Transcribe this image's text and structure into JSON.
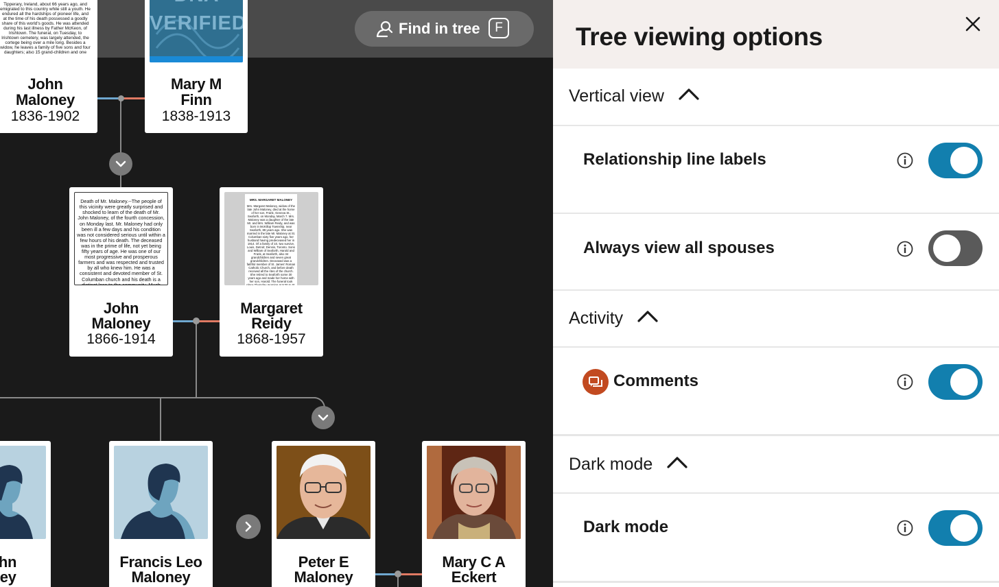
{
  "find_button": {
    "label": "Find in tree",
    "shortcut": "F"
  },
  "badge": {
    "line1": "DNA",
    "line2": "VERIFIED"
  },
  "people": [
    {
      "first": "John",
      "last": "Maloney",
      "years": "1836-1902"
    },
    {
      "first": "Mary M",
      "last": "Finn",
      "years": "1838-1913"
    },
    {
      "first": "John",
      "last": "Maloney",
      "years": "1866-1914"
    },
    {
      "first": "Margaret",
      "last": "Reidy",
      "years": "1868-1957"
    },
    {
      "first": "John",
      "last": "oney",
      "years": ""
    },
    {
      "first": "Francis Leo",
      "last": "Maloney",
      "years": ""
    },
    {
      "first": "Peter E",
      "last": "Maloney",
      "years": ""
    },
    {
      "first": "Mary C A",
      "last": "Eckert",
      "years": ""
    }
  ],
  "clippings": {
    "top_left": "Tipperary, Ireland, about 66 years ago, and emigrated to this country while still a youth. He endured all the hardships of pioneer life, and at the time of his death possessed a goodly share of this world's goods. He was attended during his last illness by Father McKeon, of Irishtown. The funeral, on Tuesday, to Irishtown cemetery, was largely attended, the cortege being over a mile long. Besides a widow, he leaves a family of five sons and four daughters; also 15 grand-children and one",
    "john_1866": "Death of Mr. Maloney.--The people of this vicinity were greatly surprised and shocked to learn of the death of Mr. John Maloney, of the fourth concession, on Monday last. Mr. Maloney had only been ill a few days and his condition was not considered serious until within a few hours of his death. The deceased was in the prime of life, not yet being fifty years of age. He was one of our most progressive and prosperous farmers and was respected and trusted by all who knew him. He was a consistent and devoted member of St. Columban church and his death is a distinct loss to the community. Much sympathy is felt for the bereaved family and friends.",
    "margaret_title": "MRS. MARGARET MALONEY",
    "margaret_body": "Mrs. Margaret Maloney, widow of the late John Maloney, died at the home of her son, Frank, Geneva St., Seaforth, on Monday, March 7. Mrs. Maloney was a daughter of the late Mr. and Mrs. William Reidy, and was born in McKillop Township, near Seaforth, 89 years ago. She was married in the late Mr. Maloney at St. Columban sixty five years ago, her husband having predeceased her in 1914. Of a family of 10, two survive, Louis, Detroit; Dennis, Toronto. Sons and William of Seaforth, Harold and Frank, at Seaforth, also 34 grandchildren and seven great grandchildren. Deceased was a faithful member of St. James' Roman Catholic Church, and before death received all the rites of the church. She retired to Seaforth some 30 years ago and made her home with her son, Harold. The funeral took place Thursday morning at 9:30 to St. James' Church, where Requiem High Mass was celebrated by Rev. Father Lane. Burial was made in St. Columban cemetery. The pallbearers were six grandsons."
  },
  "panel": {
    "title": "Tree viewing options",
    "sections": {
      "vertical_view": "Vertical view",
      "activity": "Activity",
      "dark_mode": "Dark mode"
    },
    "options": {
      "relationship_labels": {
        "label": "Relationship line labels",
        "enabled": true
      },
      "all_spouses": {
        "label": "Always view all spouses",
        "enabled": false
      },
      "comments": {
        "label": "Comments",
        "enabled": true
      },
      "dark_mode": {
        "label": "Dark mode",
        "enabled": true
      }
    }
  },
  "colors": {
    "toggle_on": "#127fae",
    "toggle_off": "#5a5a5a",
    "father_line": "#6fa8d0",
    "mother_line": "#e07a63",
    "comments_icon": "#c24a20",
    "highlight": "#e7f24a"
  }
}
